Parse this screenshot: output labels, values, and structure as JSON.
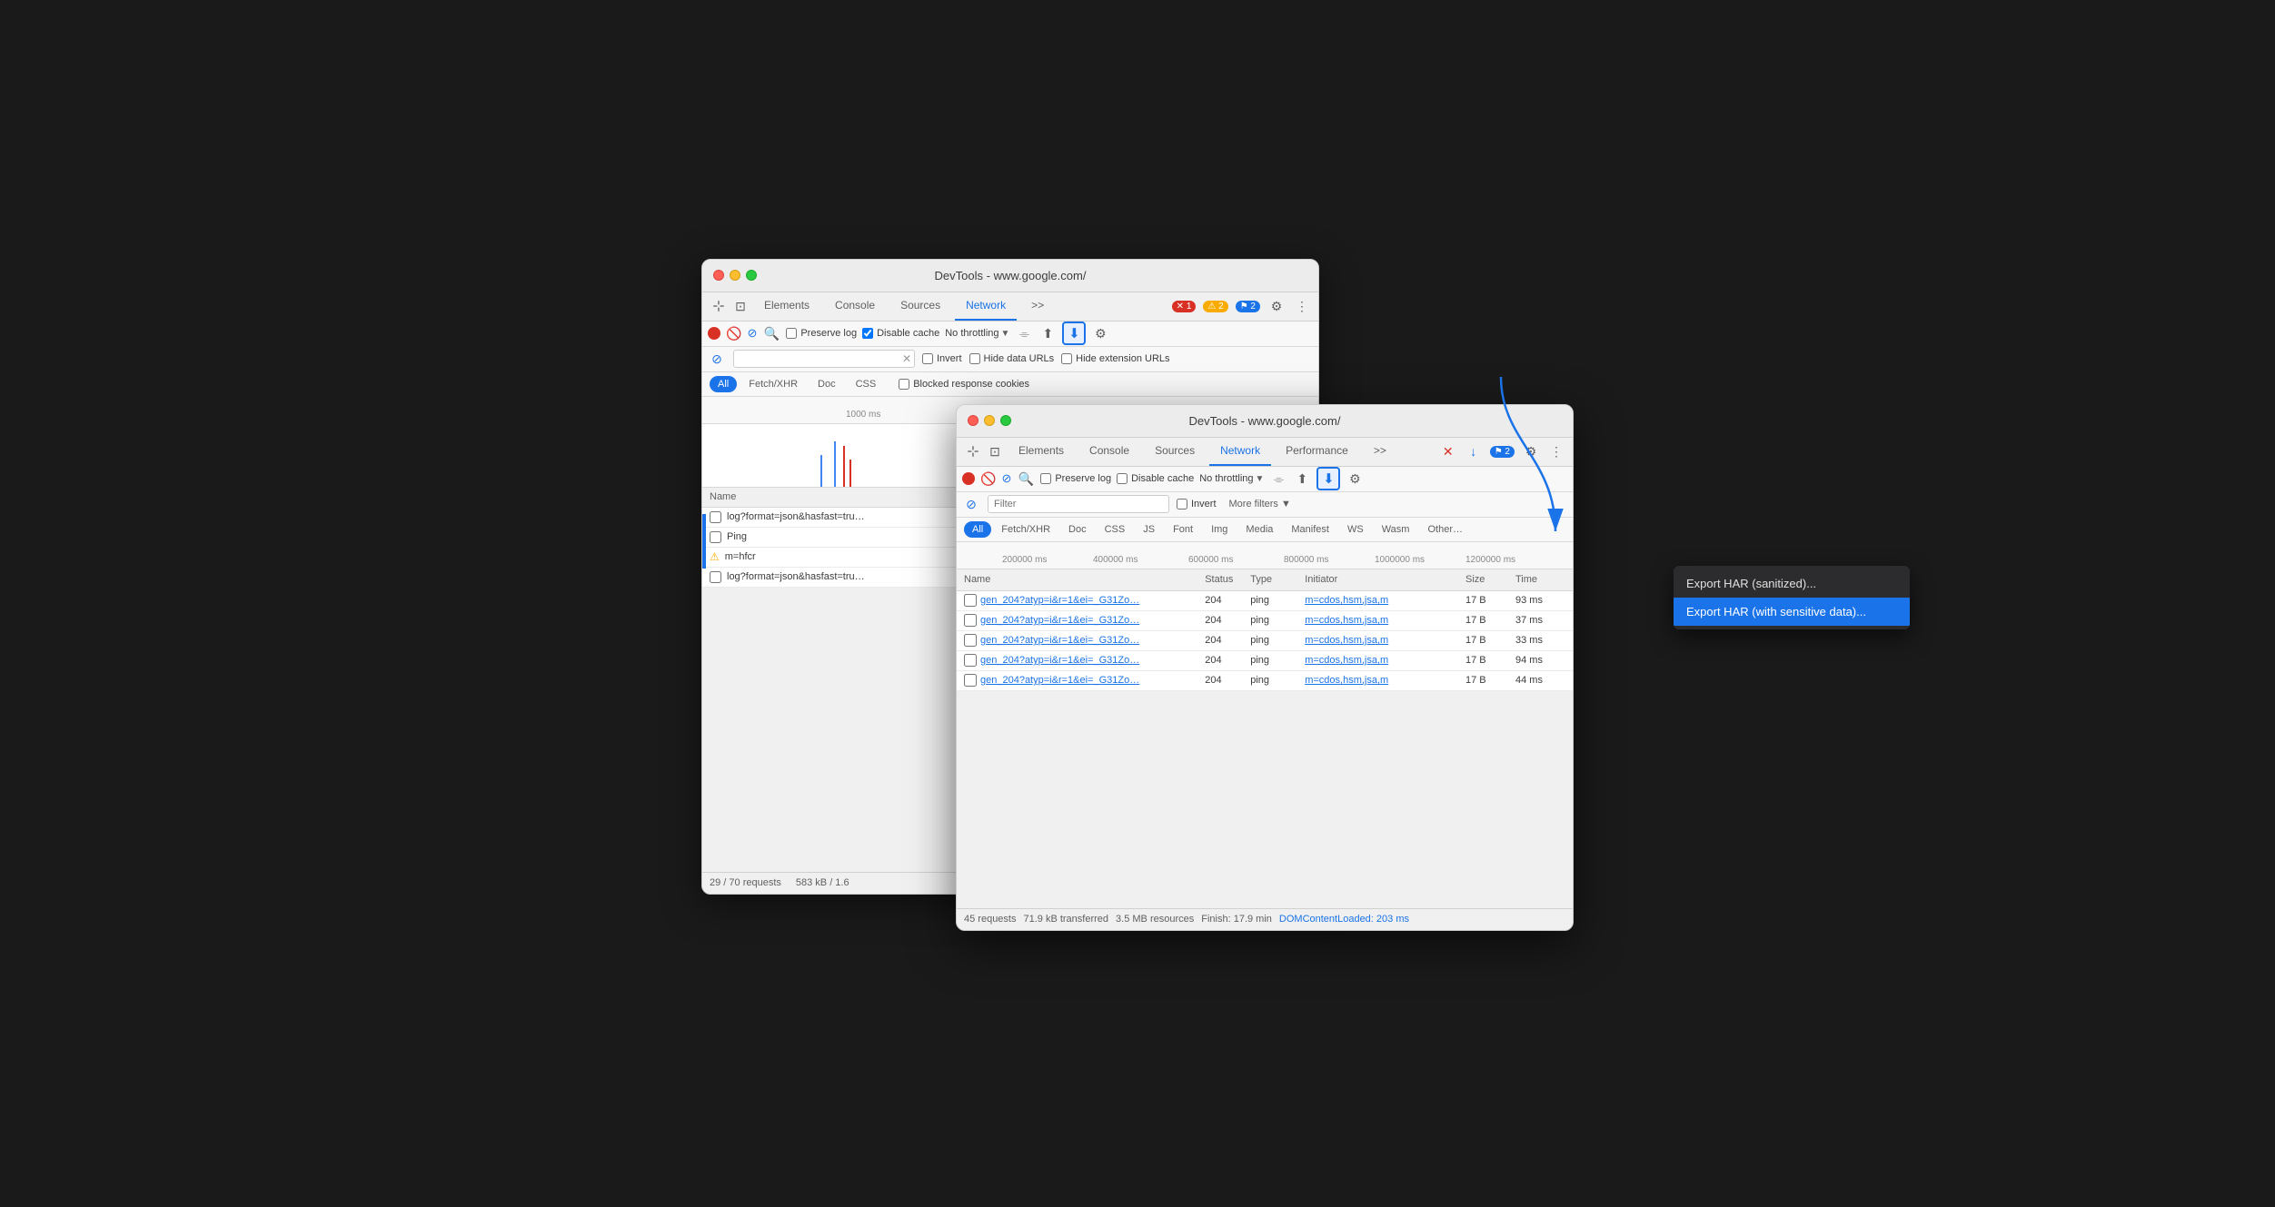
{
  "back_window": {
    "title": "DevTools - www.google.com/",
    "tabs": [
      "Elements",
      "Console",
      "Sources",
      "Network",
      ">>"
    ],
    "active_tab": "Network",
    "badges": [
      {
        "icon": "✕",
        "count": "1",
        "type": "red"
      },
      {
        "icon": "⚠",
        "count": "2",
        "type": "yellow"
      },
      {
        "icon": "⚑",
        "count": "2",
        "type": "blue"
      }
    ],
    "network_toolbar": {
      "preserve_log": false,
      "disable_cache": true,
      "throttle": "No throttling"
    },
    "filter_bar": {
      "invert": false,
      "hide_data_urls": false,
      "hide_extension_urls": false
    },
    "filter_tabs": [
      "All",
      "Fetch/XHR",
      "Doc",
      "CSS"
    ],
    "active_filter": "All",
    "checkbox_label": "Blocked response cookies",
    "timeline_labels": [
      "1000 ms"
    ],
    "name_header": "Name",
    "rows": [
      {
        "checkbox": false,
        "name": "log?format=json&hasfast=true",
        "truncated": true
      },
      {
        "checkbox": false,
        "name": "Ping"
      },
      {
        "icon": "⚠",
        "name": "m=hfcr"
      },
      {
        "checkbox": false,
        "name": "log?format=json&hasfast=true",
        "truncated": true
      }
    ],
    "status_bar": {
      "requests": "29 / 70 requests",
      "transferred": "583 kB / 1.6"
    }
  },
  "front_window": {
    "title": "DevTools - www.google.com/",
    "tabs": [
      "Elements",
      "Console",
      "Sources",
      "Network",
      "Performance",
      ">>"
    ],
    "active_tab": "Network",
    "badges": [
      {
        "count": "2",
        "type": "blue"
      }
    ],
    "network_toolbar": {
      "preserve_log": false,
      "disable_cache": false,
      "throttle": "No throttling"
    },
    "filter_placeholder": "Filter",
    "filter_tabs": [
      "All",
      "Fetch/XHR",
      "Doc",
      "CSS",
      "JS",
      "Font",
      "Img",
      "Media",
      "Manifest",
      "WS",
      "Wasm",
      "Other"
    ],
    "active_filter": "All",
    "timeline_labels": [
      "200000 ms",
      "400000 ms",
      "600000 ms",
      "800000 ms",
      "1000000 ms",
      "1200000 ms"
    ],
    "table_headers": [
      "Name",
      "Status",
      "Type",
      "Initiator",
      "Size",
      "Time"
    ],
    "rows": [
      {
        "name": "gen_204?atyp=i&r=1&ei=_G31Zo...",
        "status": "204",
        "type": "ping",
        "initiator": "m=cdos,hsm,jsa,m",
        "size": "17 B",
        "time": "93 ms"
      },
      {
        "name": "gen_204?atyp=i&r=1&ei=_G31Zo...",
        "status": "204",
        "type": "ping",
        "initiator": "m=cdos,hsm,jsa,m",
        "size": "17 B",
        "time": "37 ms"
      },
      {
        "name": "gen_204?atyp=i&r=1&ei=_G31Zo...",
        "status": "204",
        "type": "ping",
        "initiator": "m=cdos,hsm,jsa,m",
        "size": "17 B",
        "time": "33 ms"
      },
      {
        "name": "gen_204?atyp=i&r=1&ei=_G31Zo...",
        "status": "204",
        "type": "ping",
        "initiator": "m=cdos,hsm,jsa,m",
        "size": "17 B",
        "time": "94 ms"
      },
      {
        "name": "gen_204?atyp=i&r=1&ei=_G31Zo...",
        "status": "204",
        "type": "ping",
        "initiator": "m=cdos,hsm,jsa,m",
        "size": "17 B",
        "time": "44 ms"
      }
    ],
    "status_bar": {
      "requests": "45 requests",
      "transferred": "71.9 kB transferred",
      "resources": "3.5 MB resources",
      "finish": "Finish: 17.9 min",
      "dom_content_loaded": "DOMContentLoaded: 203 ms"
    }
  },
  "dropdown": {
    "items": [
      {
        "label": "Export HAR (sanitized)...",
        "highlighted": false
      },
      {
        "label": "Export HAR (with sensitive data)...",
        "highlighted": true
      }
    ]
  },
  "icons": {
    "stop": "⏹",
    "clear": "🚫",
    "filter": "⊘",
    "search": "🔍",
    "settings": "⚙",
    "more": "⋮",
    "download": "⬇",
    "upload": "⬆",
    "wifi": "⌯",
    "devtools_icon": "⛶",
    "cursor_icon": "⊹",
    "network_icon": "↔"
  }
}
